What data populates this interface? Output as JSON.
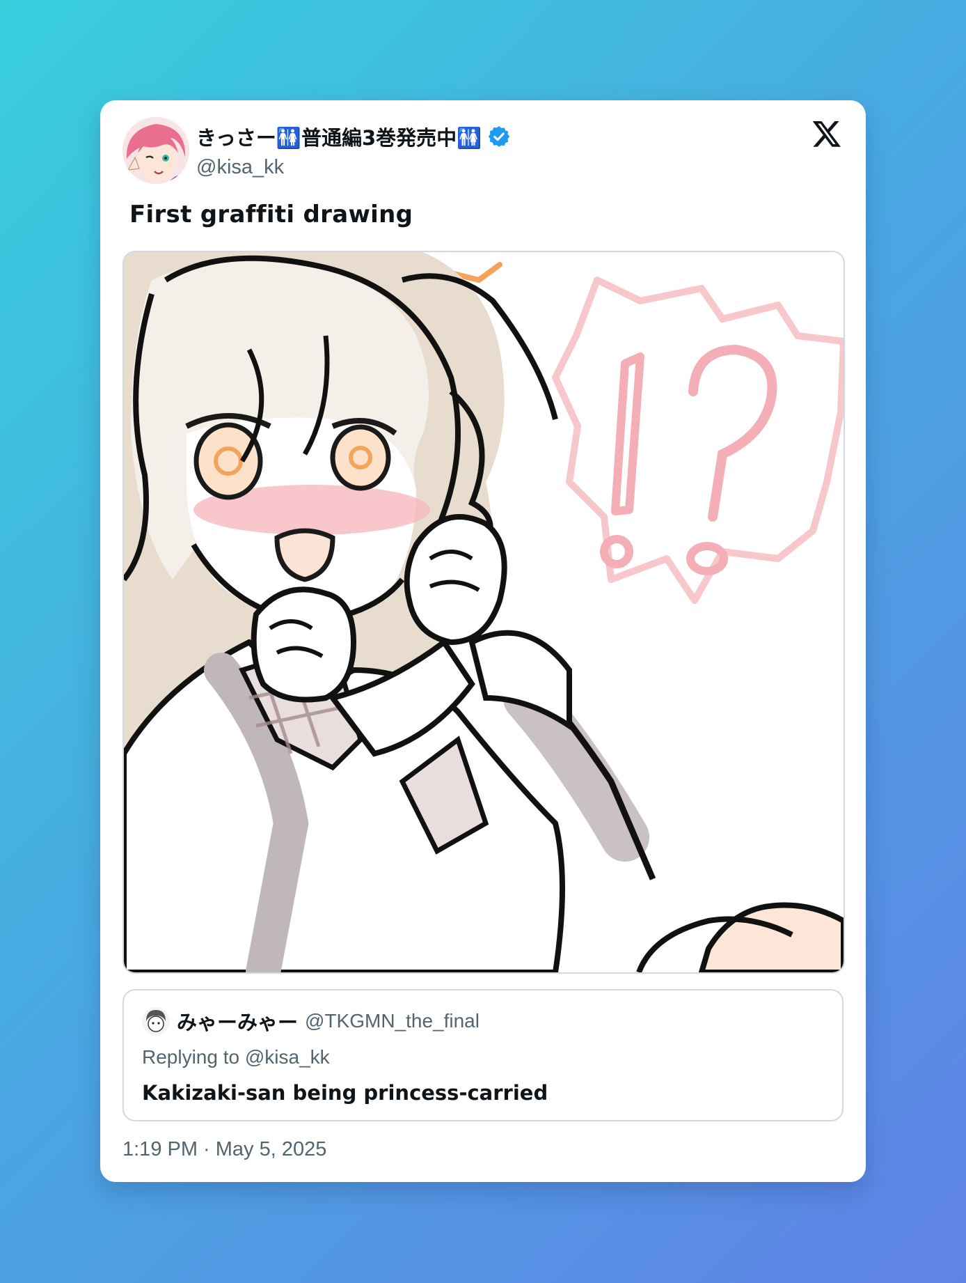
{
  "author": {
    "display_name": "きっさー🚻普通編3巻発売中🚻",
    "handle": "@kisa_kk",
    "verified": true,
    "avatar_icon": "avatar-pink-hair-anime-girl"
  },
  "tweet": {
    "text": "First graffiti drawing",
    "media_description_icon": "anime-drawing-icon",
    "timestamp": "1:19 PM · May 5, 2025"
  },
  "quote": {
    "display_name": "みゃーみゃー",
    "handle": "@TKGMN_the_final",
    "reply_to": "Replying to @kisa_kk",
    "text": "Kakizaki-san being princess-carried"
  },
  "icons": {
    "platform": "x-logo-icon",
    "verified": "verified-badge-icon"
  },
  "colors": {
    "verified_blue": "#1d9bf0",
    "text_primary": "#0f1419",
    "text_secondary": "#536471",
    "border": "#cfd9de",
    "bg_gradient_start": "#38cfdd",
    "bg_gradient_end": "#6082e6",
    "sfx_pink": "#f6b9c0",
    "sfx_orange": "#f3a35a"
  }
}
